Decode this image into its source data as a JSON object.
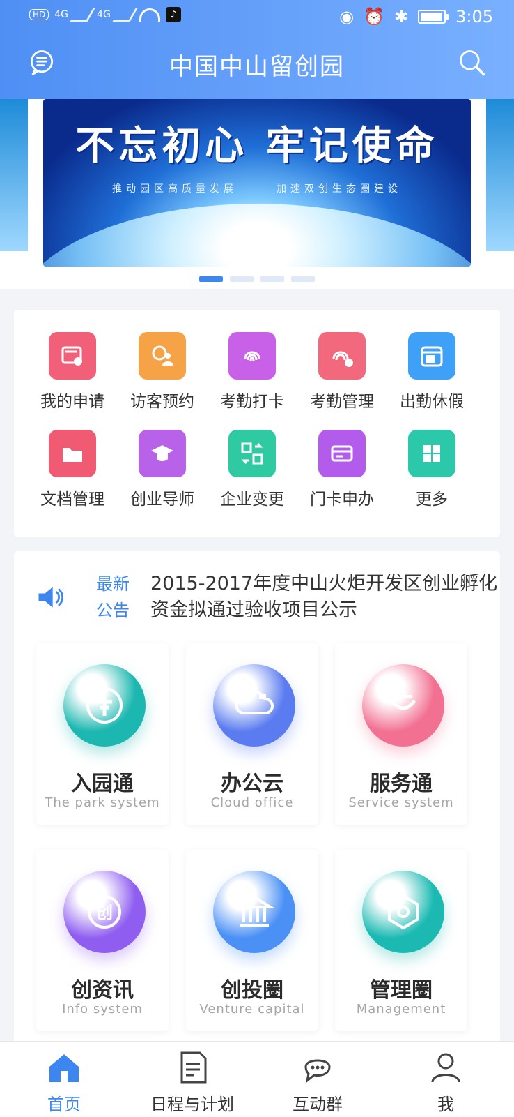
{
  "header": {
    "title": "中国中山留创园",
    "status": {
      "left_tags": [
        "HD",
        "4G",
        "4G"
      ],
      "time": "3:05",
      "battery_level": 1.0
    }
  },
  "banner": {
    "title": "不忘初心 牢记使命",
    "subtitles": [
      "推动园区高质量发展",
      "加速双创生态圈建设"
    ],
    "pagination_count": 4,
    "active_index": 0
  },
  "grid": [
    {
      "label": "我的申请",
      "icon": "application-icon",
      "color": "#f25f78"
    },
    {
      "label": "访客预约",
      "icon": "visitor-icon",
      "color": "#f6a347"
    },
    {
      "label": "考勤打卡",
      "icon": "fingerprint-icon",
      "color": "#c960e8"
    },
    {
      "label": "考勤管理",
      "icon": "fingerprint-settings-icon",
      "color": "#f2687d"
    },
    {
      "label": "出勤休假",
      "icon": "calendar-icon",
      "color": "#3ea0f6"
    },
    {
      "label": "文档管理",
      "icon": "folder-icon",
      "color": "#f05a72"
    },
    {
      "label": "创业导师",
      "icon": "mentor-cap-icon",
      "color": "#b762e8"
    },
    {
      "label": "企业变更",
      "icon": "exchange-icon",
      "color": "#2fcaa2"
    },
    {
      "label": "门卡申办",
      "icon": "card-icon",
      "color": "#b35ceb"
    },
    {
      "label": "更多",
      "icon": "grid-more-icon",
      "color": "#2bc8a9"
    }
  ],
  "announcement": {
    "label": "最新公告",
    "text": "2015-2017年度中山火炬开发区创业孵化资金拟通过验收项目公示"
  },
  "cards": [
    {
      "title": "入园通",
      "subtitle": "The park system",
      "icon": "signpost-icon",
      "color": "#1cb7b0"
    },
    {
      "title": "办公云",
      "subtitle": "Cloud office",
      "icon": "cloud-icon",
      "color": "#5b7cf0"
    },
    {
      "title": "服务通",
      "subtitle": "Service system",
      "icon": "smile-icon",
      "color": "#f27193"
    },
    {
      "title": "创资讯",
      "subtitle": "Info system",
      "icon": "info-chuang-icon",
      "color": "#8f5ef0"
    },
    {
      "title": "创投圈",
      "subtitle": "Venture capital",
      "icon": "bank-icon",
      "color": "#4a90f5"
    },
    {
      "title": "管理圈",
      "subtitle": "Management",
      "icon": "hexagon-icon",
      "color": "#1bb9b2"
    }
  ],
  "nav": [
    {
      "label": "首页",
      "icon": "home-icon",
      "active": true
    },
    {
      "label": "日程与计划",
      "icon": "schedule-icon",
      "active": false
    },
    {
      "label": "互动群",
      "icon": "chat-icon",
      "active": false
    },
    {
      "label": "我",
      "icon": "profile-icon",
      "active": false
    }
  ]
}
